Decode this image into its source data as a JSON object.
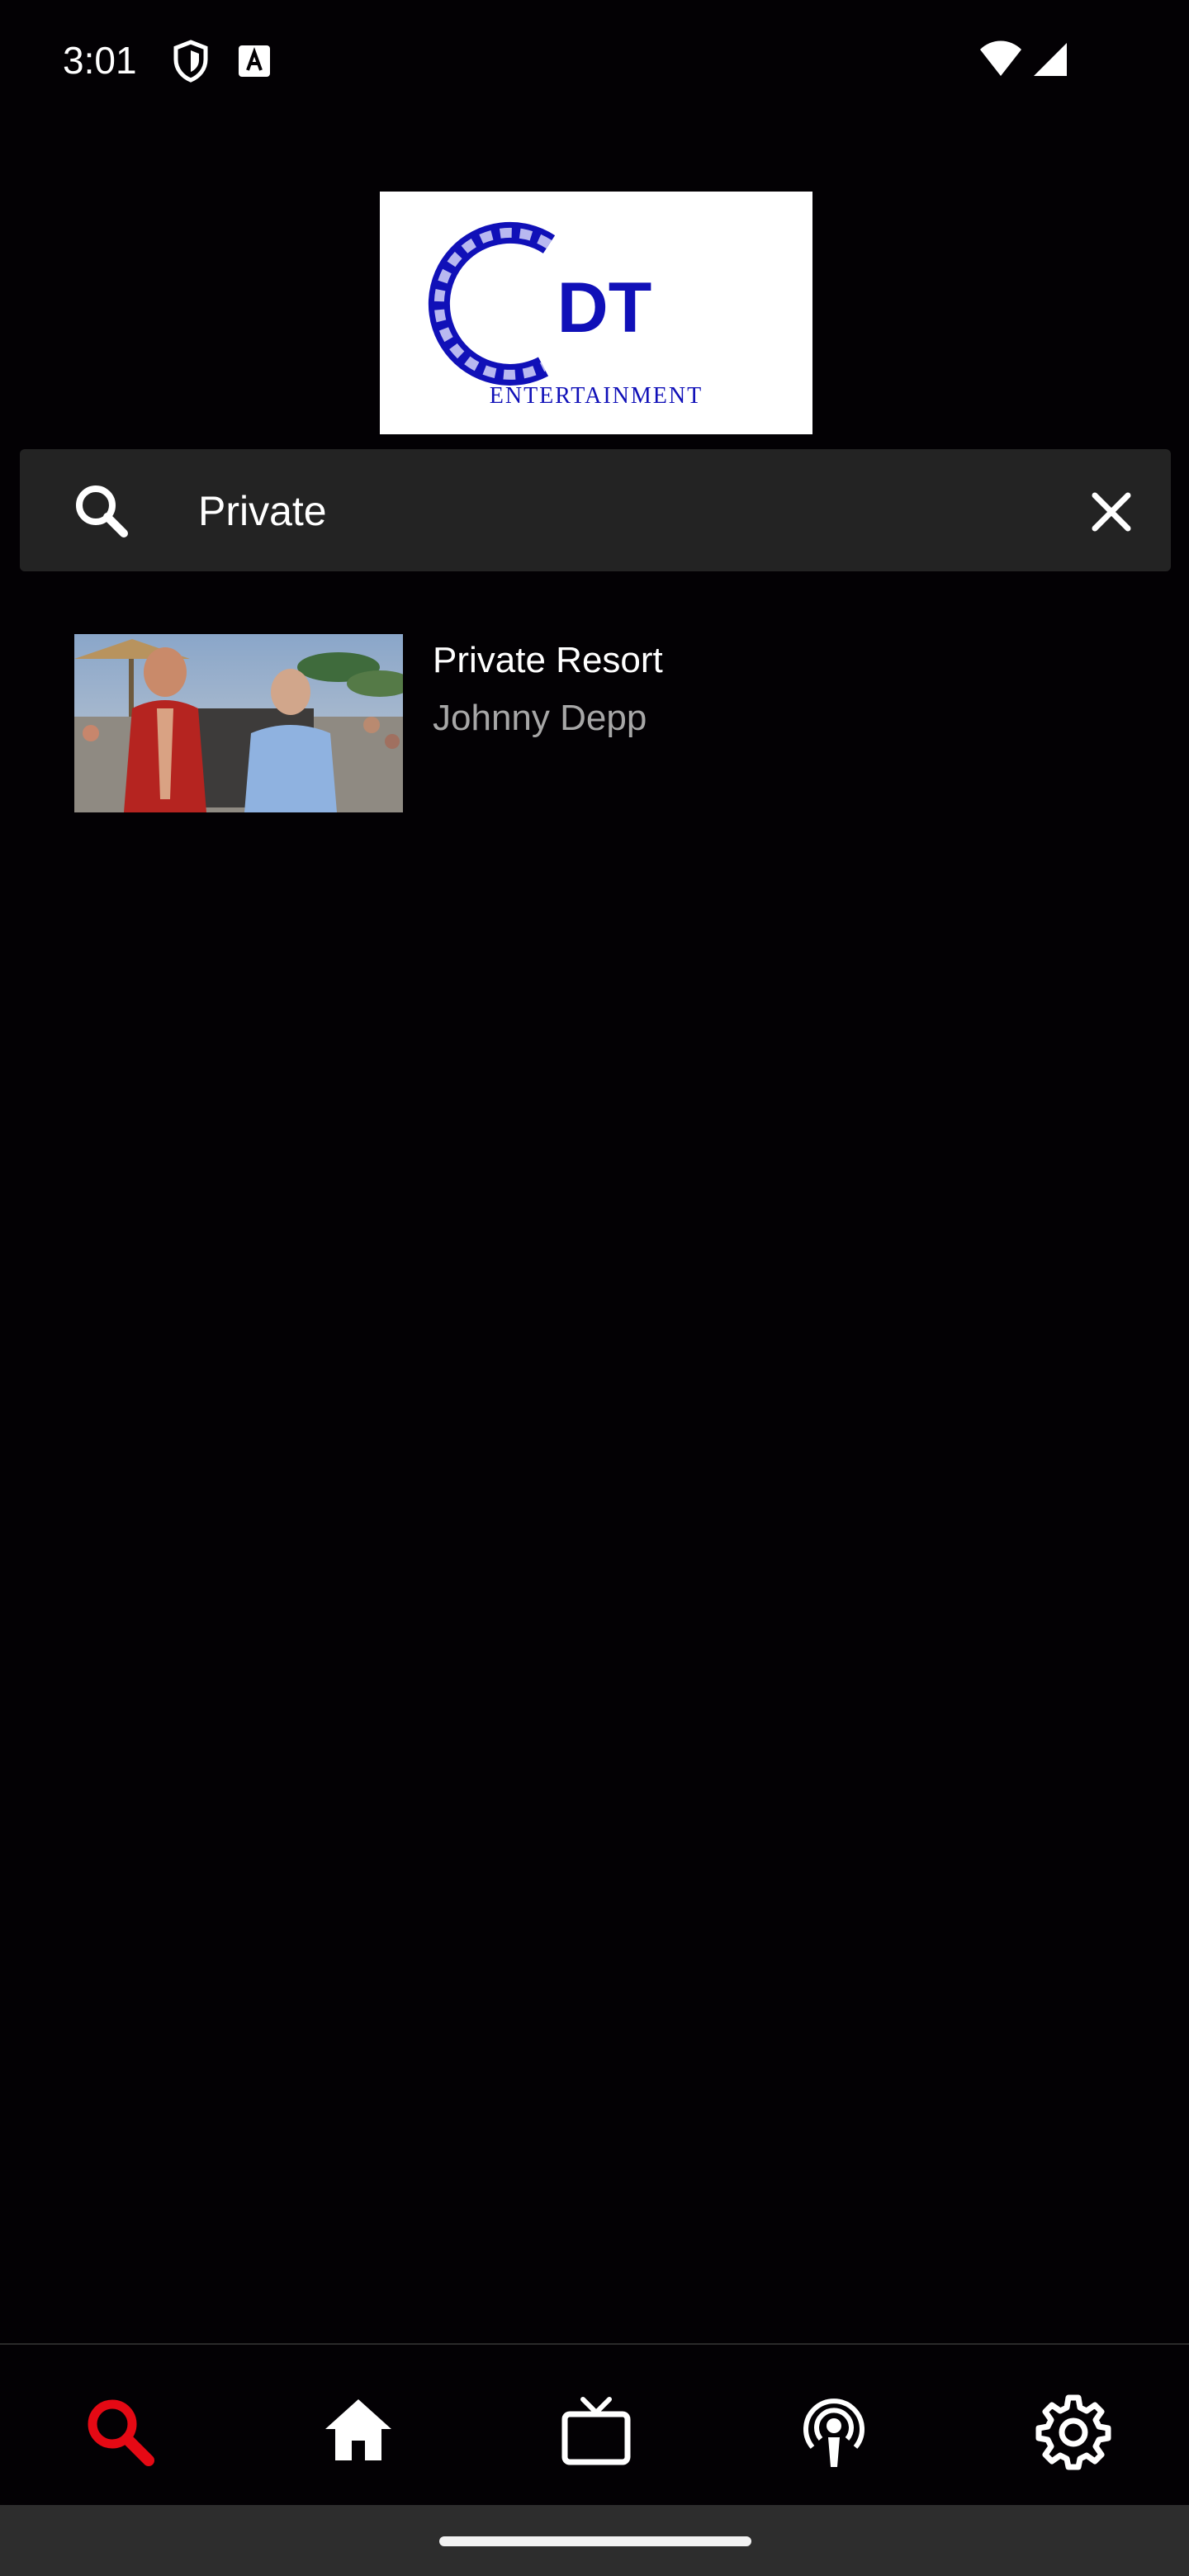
{
  "status_bar": {
    "time": "3:01",
    "icons": [
      "shield-icon",
      "font-a-icon",
      "wifi-icon",
      "cellular-signal-icon"
    ]
  },
  "logo": {
    "initials": "DT",
    "text": "ENTERTAINMENT",
    "color": "#1010b8"
  },
  "search": {
    "value": "Private",
    "icon": "search-icon",
    "clear_icon": "close-icon"
  },
  "results": [
    {
      "title": "Private Resort",
      "subtitle": "Johnny Depp"
    }
  ],
  "bottom_nav": {
    "active_color": "#e50914",
    "items": [
      {
        "icon": "search-icon",
        "active": true
      },
      {
        "icon": "home-icon",
        "active": false
      },
      {
        "icon": "tv-icon",
        "active": false
      },
      {
        "icon": "podcast-icon",
        "active": false
      },
      {
        "icon": "gear-icon",
        "active": false
      }
    ]
  }
}
